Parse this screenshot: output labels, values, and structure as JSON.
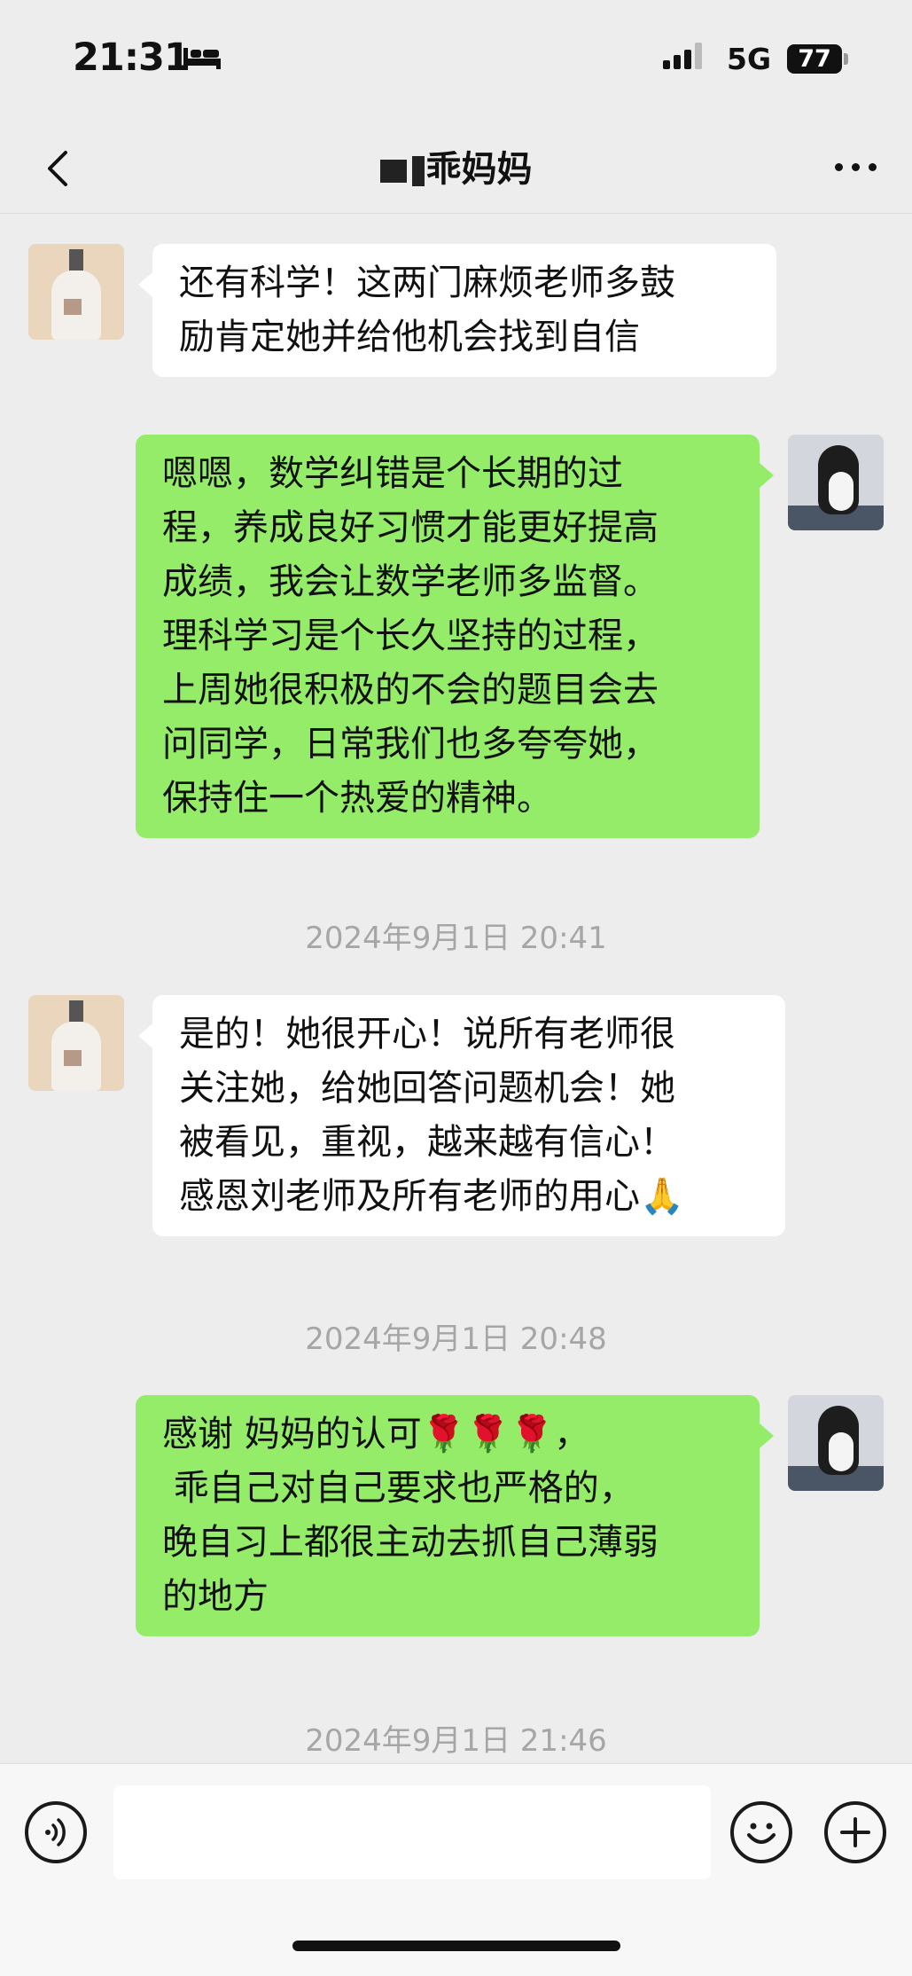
{
  "status": {
    "time": "21:31",
    "network": "5G",
    "battery": "77"
  },
  "nav": {
    "title": "乖妈妈"
  },
  "messages": [
    {
      "side": "left",
      "text": "还有科学！这两门麻烦老师多鼓\n励肯定她并给他机会找到自信"
    },
    {
      "side": "right",
      "text": "嗯嗯，数学纠错是个长期的过\n程，养成良好习惯才能更好提高\n成绩，我会让数学老师多监督。\n理科学习是个长久坚持的过程，\n上周她很积极的不会的题目会去\n问同学，日常我们也多夸夸她，\n保持住一个热爱的精神。"
    },
    {
      "side": "left",
      "text": "是的！她很开心！说所有老师很\n关注她，给她回答问题机会！她\n被看见，重视，越来越有信心！\n感恩刘老师及所有老师的用心🙏"
    },
    {
      "side": "right",
      "text": "感谢 妈妈的认可🌹🌹🌹，\n 乖自己对自己要求也严格的，\n晚自习上都很主动去抓自己薄弱\n的地方"
    }
  ],
  "timestamps": [
    "2024年9月1日 20:41",
    "2024年9月1日 20:48",
    "2024年9月1日 21:46"
  ],
  "input": {
    "placeholder": ""
  },
  "icons": {
    "back": "chevron-left-icon",
    "more": "more-dots-icon",
    "voice": "voice-icon",
    "emoji": "emoji-icon",
    "plus": "plus-icon"
  }
}
